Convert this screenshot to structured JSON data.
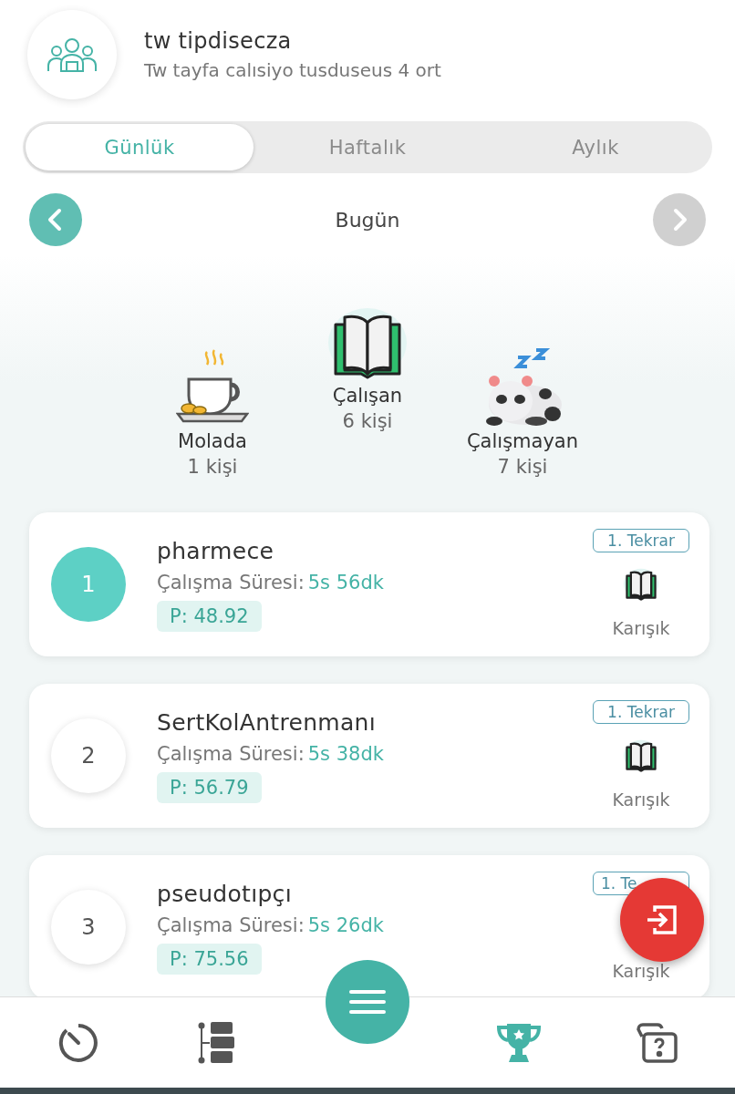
{
  "header": {
    "title": "tw tipdisecza",
    "subtitle": "Tw tayfa calısiyo tusduseus 4 ort"
  },
  "tabs": [
    {
      "label": "Günlük",
      "selected": true
    },
    {
      "label": "Haftalık",
      "selected": false
    },
    {
      "label": "Aylık",
      "selected": false
    }
  ],
  "day_nav": {
    "label": "Bugün",
    "prev_disabled": false,
    "next_disabled": true
  },
  "status_groups": [
    {
      "kind": "coffee",
      "label": "Molada",
      "count": "1 kişi"
    },
    {
      "kind": "book",
      "label": "Çalışan",
      "count": "6 kişi"
    },
    {
      "kind": "panda",
      "label": "Çalışmayan",
      "count": "7 kişi"
    }
  ],
  "leaderboard": [
    {
      "rank": "1",
      "highlighted": true,
      "name": "pharmece",
      "duration_label": "Çalışma Süresi:",
      "duration": "5s 56dk",
      "score": "P: 48.92",
      "tag": "1. Tekrar",
      "mode_icon": true,
      "mode": "Karışık"
    },
    {
      "rank": "2",
      "highlighted": false,
      "name": "SertKolAntrenmanı",
      "duration_label": "Çalışma Süresi:",
      "duration": "5s 38dk",
      "score": "P: 56.79",
      "tag": "1. Tekrar",
      "mode_icon": true,
      "mode": "Karışık"
    },
    {
      "rank": "3",
      "highlighted": false,
      "name": "pseudotıpçı",
      "duration_label": "Çalışma Süresi:",
      "duration": "5s 26dk",
      "score": "P: 75.56",
      "tag": "1. Te",
      "mode_icon": false,
      "mode": "Karışık"
    }
  ],
  "bottom_nav": [
    {
      "kind": "timer",
      "selected": false
    },
    {
      "kind": "list",
      "selected": false
    },
    {
      "kind": "trophy",
      "selected": true
    },
    {
      "kind": "cards",
      "selected": false
    }
  ]
}
